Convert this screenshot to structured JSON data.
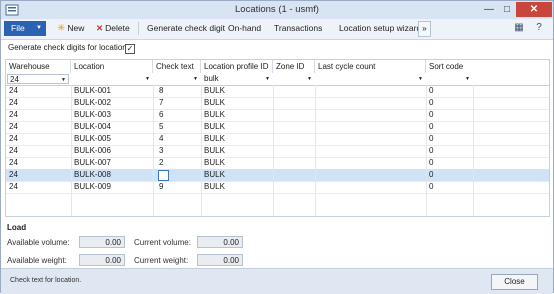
{
  "window": {
    "title": "Locations (1 - usmf)",
    "minimize_icon": "minimize-icon",
    "maximize_icon": "maximize-icon",
    "close_icon": "close-icon"
  },
  "toolbar": {
    "file_label": "File",
    "new_label": "New",
    "delete_label": "Delete",
    "generate_label": "Generate check digit",
    "onhand_label": "On-hand",
    "transactions_label": "Transactions",
    "wizard_label": "Location setup wizard",
    "more_label": "»"
  },
  "option": {
    "label": "Generate check digits for location:",
    "checked": true
  },
  "grid": {
    "columns": [
      "Warehouse",
      "Location",
      "Check text",
      "Location profile ID",
      "Zone ID",
      "Last cycle count",
      "Sort code"
    ],
    "filters": {
      "warehouse": "24",
      "location": "",
      "check_text": "",
      "profile": "bulk",
      "zone": "",
      "last_cycle": "",
      "sort": ""
    },
    "rows": [
      {
        "warehouse": "24",
        "location": "BULK-001",
        "check": "8",
        "profile": "BULK",
        "zone": "",
        "last_cycle": "",
        "sort": "0"
      },
      {
        "warehouse": "24",
        "location": "BULK-002",
        "check": "7",
        "profile": "BULK",
        "zone": "",
        "last_cycle": "",
        "sort": "0"
      },
      {
        "warehouse": "24",
        "location": "BULK-003",
        "check": "6",
        "profile": "BULK",
        "zone": "",
        "last_cycle": "",
        "sort": "0"
      },
      {
        "warehouse": "24",
        "location": "BULK-004",
        "check": "5",
        "profile": "BULK",
        "zone": "",
        "last_cycle": "",
        "sort": "0"
      },
      {
        "warehouse": "24",
        "location": "BULK-005",
        "check": "4",
        "profile": "BULK",
        "zone": "",
        "last_cycle": "",
        "sort": "0"
      },
      {
        "warehouse": "24",
        "location": "BULK-006",
        "check": "3",
        "profile": "BULK",
        "zone": "",
        "last_cycle": "",
        "sort": "0"
      },
      {
        "warehouse": "24",
        "location": "BULK-007",
        "check": "2",
        "profile": "BULK",
        "zone": "",
        "last_cycle": "",
        "sort": "0"
      },
      {
        "warehouse": "24",
        "location": "BULK-008",
        "check": "",
        "profile": "BULK",
        "zone": "",
        "last_cycle": "",
        "sort": "0"
      },
      {
        "warehouse": "24",
        "location": "BULK-009",
        "check": "9",
        "profile": "BULK",
        "zone": "",
        "last_cycle": "",
        "sort": "0"
      }
    ]
  },
  "load": {
    "heading": "Load",
    "available_volume_label": "Available volume:",
    "available_volume": "0.00",
    "current_volume_label": "Current volume:",
    "current_volume": "0.00",
    "available_weight_label": "Available weight:",
    "available_weight": "0.00",
    "current_weight_label": "Current weight:",
    "current_weight": "0.00"
  },
  "status": {
    "text": "Check text for location.",
    "close_label": "Close"
  },
  "colors": {
    "accent": "#2b63b2",
    "selected_row": "#cfe2f6",
    "delete_red": "#c0392b",
    "titlebar": "#d8e4f4"
  }
}
